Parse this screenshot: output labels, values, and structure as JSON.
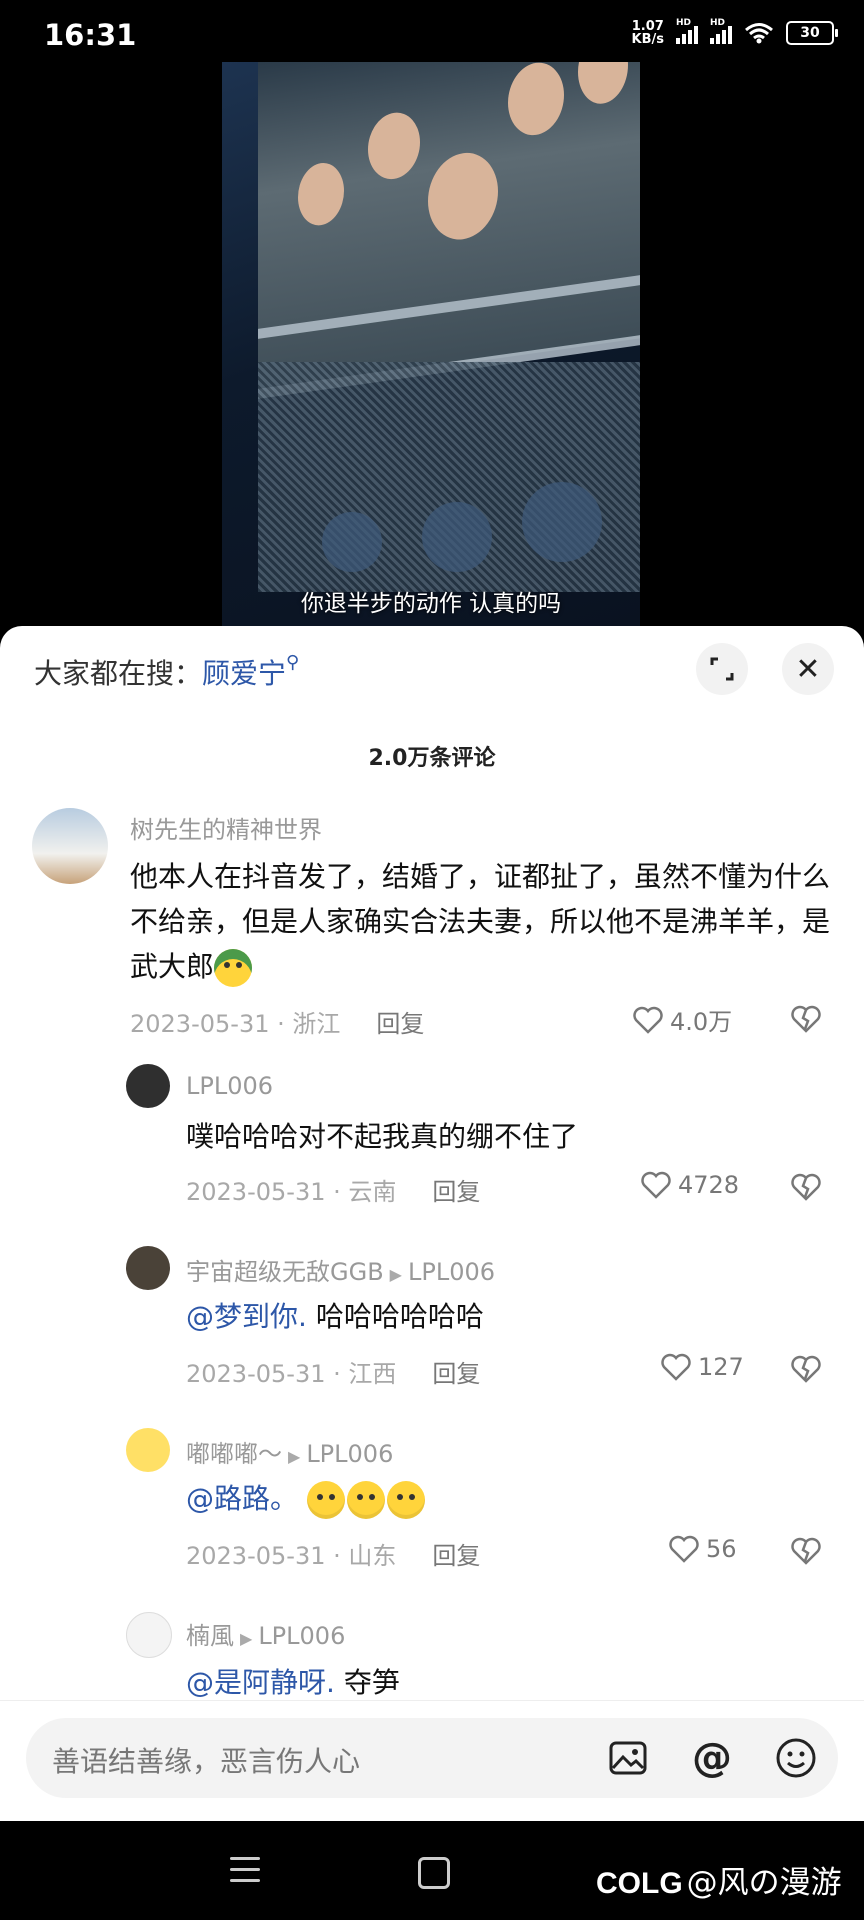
{
  "status_bar": {
    "time": "16:31",
    "net_speed_value": "1.07",
    "net_speed_unit": "KB/s",
    "hd_label": "HD",
    "battery": "30"
  },
  "video": {
    "subtitle": "你退半步的动作 认真的吗"
  },
  "search_bar": {
    "prefix": "大家都在搜：",
    "keyword": "顾爱宁"
  },
  "comments_count": "2.0万条评论",
  "reply_label": "回复",
  "comments": [
    {
      "username": "树先生的精神世界",
      "text": "他本人在抖音发了，结婚了，证都扯了，虽然不懂为什么不给亲，但是人家确实合法夫妻，所以他不是沸羊羊，是武大郎",
      "date": "2023-05-31",
      "location": "浙江",
      "likes": "4.0万"
    },
    {
      "username": "LPL006",
      "text": "噗哈哈哈对不起我真的绷不住了",
      "date": "2023-05-31",
      "location": "云南",
      "likes": "4728"
    },
    {
      "username": "宇宙超级无敌GGB",
      "reply_to": "LPL006",
      "mention": "@梦到你.",
      "text": "哈哈哈哈哈哈",
      "date": "2023-05-31",
      "location": "江西",
      "likes": "127"
    },
    {
      "username": "嘟嘟嘟～",
      "reply_to": "LPL006",
      "mention": "@路路。",
      "text": "",
      "date": "2023-05-31",
      "location": "山东",
      "likes": "56"
    },
    {
      "username": "楠風",
      "reply_to": "LPL006",
      "mention": "@是阿静呀.",
      "text": "夺笋"
    }
  ],
  "input": {
    "placeholder": "善语结善缘，恶言伤人心"
  },
  "watermark": {
    "brand": "COLG",
    "author": "@风の漫游"
  }
}
